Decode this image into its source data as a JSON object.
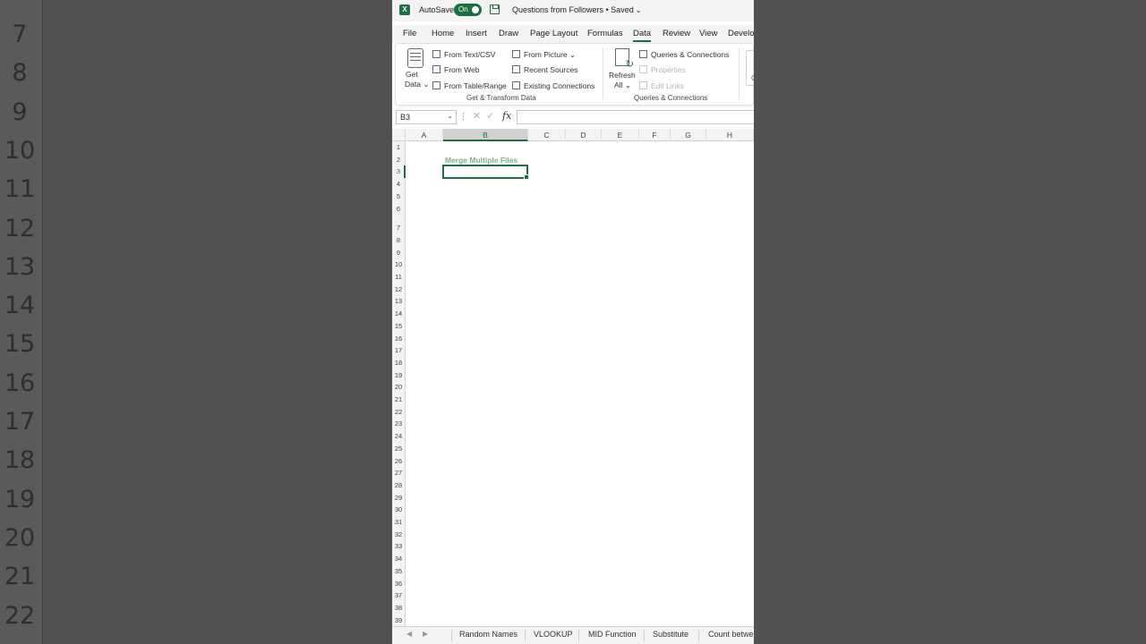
{
  "background_row_numbers": [
    "7",
    "8",
    "9",
    "10",
    "11",
    "12",
    "13",
    "14",
    "15",
    "16",
    "17",
    "18",
    "19",
    "20",
    "21",
    "22"
  ],
  "titlebar": {
    "app_icon": "excel-logo-icon",
    "autosave_label": "AutoSave",
    "autosave_state": "On",
    "save_icon": "save-icon",
    "doc_title": "Questions from Followers • Saved"
  },
  "tabs": [
    "File",
    "Home",
    "Insert",
    "Draw",
    "Page Layout",
    "Formulas",
    "Data",
    "Review",
    "View",
    "Develop"
  ],
  "active_tab": "Data",
  "ribbon": {
    "get_data": {
      "line1": "Get",
      "line2": "Data"
    },
    "get_transform": {
      "from_text_csv": "From Text/CSV",
      "from_web": "From Web",
      "from_table_range": "From Table/Range",
      "from_picture": "From Picture",
      "recent_sources": "Recent Sources",
      "existing_connections": "Existing Connections",
      "group_label": "Get & Transform Data"
    },
    "refresh": {
      "line1": "Refresh",
      "line2": "All"
    },
    "queries": {
      "queries_connections": "Queries & Connections",
      "properties": "Properties",
      "edit_links": "Edit Links",
      "group_label": "Queries & Connections"
    },
    "cut_off_label": "G"
  },
  "formula_bar": {
    "name_box": "B3",
    "fx_label": "fx",
    "formula": ""
  },
  "columns": [
    "A",
    "B",
    "C",
    "D",
    "E",
    "F",
    "G",
    "H"
  ],
  "selected_column": "B",
  "rows": [
    "1",
    "2",
    "3",
    "4",
    "5",
    "6",
    "7",
    "8",
    "9",
    "10",
    "11",
    "12",
    "13",
    "14",
    "15",
    "16",
    "17",
    "18",
    "19",
    "20",
    "21",
    "22",
    "23",
    "24",
    "25",
    "26",
    "27",
    "28",
    "29",
    "30",
    "31",
    "32",
    "33",
    "34",
    "35",
    "36",
    "37",
    "38",
    "39"
  ],
  "selected_row": "3",
  "cells": {
    "B2": "Merge Multiple Files"
  },
  "colors": {
    "accent": "#1d6f42",
    "title_text": "#7fb08a"
  },
  "sheet_tabs": [
    "Random Names",
    "VLOOKUP",
    "MID Function",
    "Substitute",
    "Count betwe"
  ]
}
